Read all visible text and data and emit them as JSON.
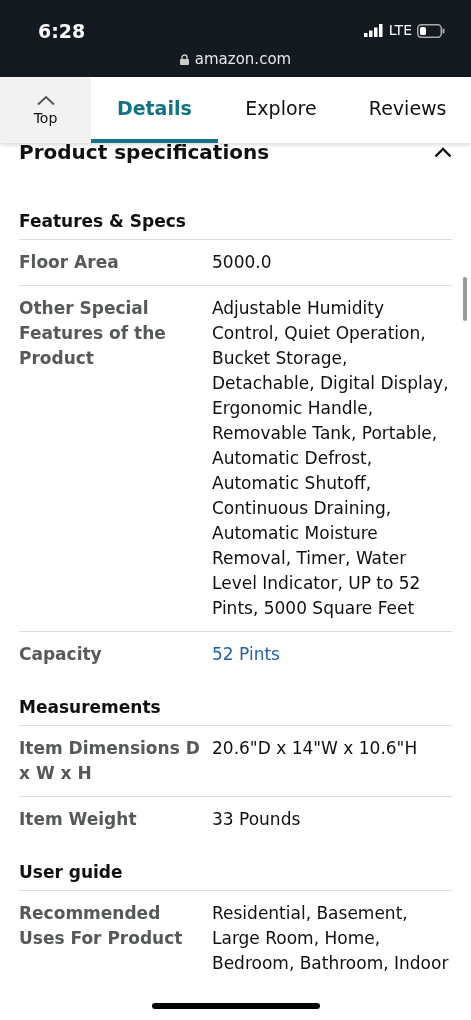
{
  "status_bar": {
    "time": "6:28",
    "network": "LTE",
    "url": "amazon.com"
  },
  "nav": {
    "top_label": "Top",
    "tabs": [
      {
        "label": "Details",
        "selected": true
      },
      {
        "label": "Explore",
        "selected": false
      },
      {
        "label": "Reviews",
        "selected": false
      }
    ]
  },
  "title": "Product specifications",
  "sections": [
    {
      "title": "Features & Specs",
      "rows": [
        {
          "label": "Floor Area",
          "value": "5000.0",
          "kind": "text"
        },
        {
          "label": "Other Special Features of the Product",
          "value": "Adjustable Humidity Control, Quiet Operation, Bucket Storage, Detachable, Digital Display, Ergonomic Handle, Removable Tank, Portable, Automatic Defrost, Automatic Shutoff, Continuous Draining, Automatic Moisture Removal, Timer, Water Level Indicator, UP to 52 Pints, 5000 Square Feet",
          "kind": "text"
        },
        {
          "label": "Capacity",
          "value": "52 Pints",
          "kind": "link"
        }
      ]
    },
    {
      "title": "Measurements",
      "rows": [
        {
          "label": "Item Dimensions D x W x H",
          "value": "20.6\"D x 14\"W x 10.6\"H",
          "kind": "text"
        },
        {
          "label": "Item Weight",
          "value": "33 Pounds",
          "kind": "text"
        }
      ]
    },
    {
      "title": "User guide",
      "rows": [
        {
          "label": "Recommended Uses For Product",
          "value": "Residential, Basement, Large Room, Home, Bedroom, Bathroom, Indoor",
          "kind": "text"
        }
      ]
    }
  ]
}
